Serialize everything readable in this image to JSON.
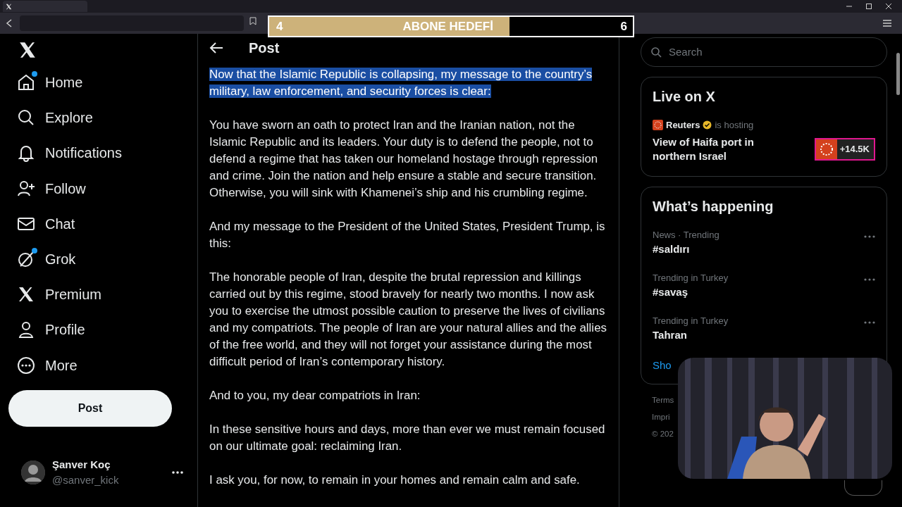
{
  "overlay": {
    "label": "ABONE HEDEFİ",
    "current": "4",
    "target": "6",
    "level": 0.66
  },
  "sidebar": {
    "items": [
      {
        "kind": "home",
        "label": "Home",
        "dot": true
      },
      {
        "kind": "explore",
        "label": "Explore",
        "dot": false
      },
      {
        "kind": "notifications",
        "label": "Notifications",
        "dot": false
      },
      {
        "kind": "follow",
        "label": "Follow",
        "dot": false
      },
      {
        "kind": "chat",
        "label": "Chat",
        "dot": false
      },
      {
        "kind": "grok",
        "label": "Grok",
        "dot": true
      },
      {
        "kind": "premium",
        "label": "Premium",
        "dot": false
      },
      {
        "kind": "profile",
        "label": "Profile",
        "dot": false
      },
      {
        "kind": "more",
        "label": "More",
        "dot": false
      }
    ],
    "post_button": "Post",
    "account": {
      "name": "Şanver Koç",
      "handle": "@sanver_kick"
    }
  },
  "post": {
    "title": "Post",
    "paragraphs": [
      {
        "text": "Now that the Islamic Republic is collapsing, my message to the country’s military, law enforcement, and security forces is clear:",
        "highlighted": true
      },
      {
        "text": "You have sworn an oath to protect Iran and the Iranian nation, not the Islamic Republic and its leaders. Your duty is to defend the people, not to defend a regime that has taken our homeland hostage through repression and crime. Join the nation and help ensure a stable and secure transition. Otherwise, you will sink with Khamenei’s ship and his crumbling regime.",
        "highlighted": false
      },
      {
        "text": "And my message to the President of the United States, President Trump, is this:",
        "highlighted": false
      },
      {
        "text": "The honorable people of Iran, despite the brutal repression and killings carried out by this regime, stood bravely for nearly two months. I now ask you to exercise the utmost possible caution to preserve the lives of civilians and my compatriots. The people of Iran are your natural allies and the allies of the free world, and they will not forget your assistance during the most difficult period of Iran’s contemporary history.",
        "highlighted": false
      },
      {
        "text": "And to you, my dear compatriots in Iran:",
        "highlighted": false
      },
      {
        "text": "In these sensitive hours and days, more than ever we must remain focused on our ultimate goal: reclaiming Iran.",
        "highlighted": false
      },
      {
        "text": "I ask you, for now, to remain in your homes and remain calm and safe.",
        "highlighted": false
      }
    ]
  },
  "search": {
    "placeholder": "Search"
  },
  "live": {
    "title": "Live on X",
    "host": "Reuters",
    "status": "is hosting",
    "headline": "View of Haifa port in northern Israel",
    "count": "+14.5K"
  },
  "happening": {
    "title": "What’s happening",
    "trends": [
      {
        "context": "News · Trending",
        "topic": "#saldırı"
      },
      {
        "context": "Trending in Turkey",
        "topic": "#savaş"
      },
      {
        "context": "Trending in Turkey",
        "topic": "Tahran"
      }
    ],
    "show_more": "Sho"
  },
  "footer": [
    "Terms",
    "Impri",
    "© 202"
  ]
}
